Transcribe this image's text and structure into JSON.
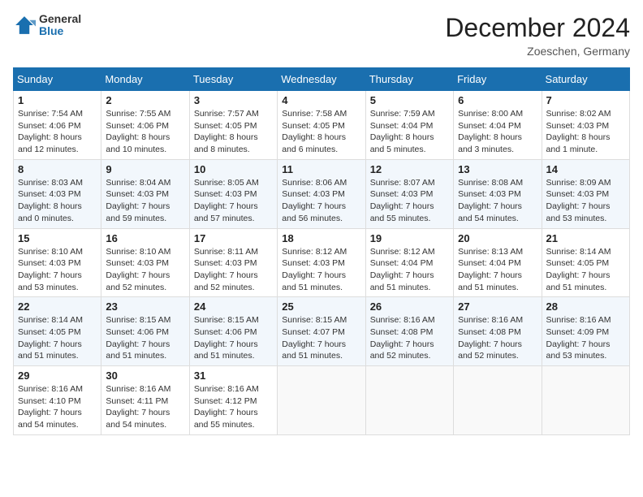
{
  "logo": {
    "general": "General",
    "blue": "Blue"
  },
  "title": "December 2024",
  "location": "Zoeschen, Germany",
  "days_of_week": [
    "Sunday",
    "Monday",
    "Tuesday",
    "Wednesday",
    "Thursday",
    "Friday",
    "Saturday"
  ],
  "weeks": [
    [
      {
        "day": "1",
        "sunrise": "7:54 AM",
        "sunset": "4:06 PM",
        "daylight": "8 hours and 12 minutes."
      },
      {
        "day": "2",
        "sunrise": "7:55 AM",
        "sunset": "4:06 PM",
        "daylight": "8 hours and 10 minutes."
      },
      {
        "day": "3",
        "sunrise": "7:57 AM",
        "sunset": "4:05 PM",
        "daylight": "8 hours and 8 minutes."
      },
      {
        "day": "4",
        "sunrise": "7:58 AM",
        "sunset": "4:05 PM",
        "daylight": "8 hours and 6 minutes."
      },
      {
        "day": "5",
        "sunrise": "7:59 AM",
        "sunset": "4:04 PM",
        "daylight": "8 hours and 5 minutes."
      },
      {
        "day": "6",
        "sunrise": "8:00 AM",
        "sunset": "4:04 PM",
        "daylight": "8 hours and 3 minutes."
      },
      {
        "day": "7",
        "sunrise": "8:02 AM",
        "sunset": "4:03 PM",
        "daylight": "8 hours and 1 minute."
      }
    ],
    [
      {
        "day": "8",
        "sunrise": "8:03 AM",
        "sunset": "4:03 PM",
        "daylight": "8 hours and 0 minutes."
      },
      {
        "day": "9",
        "sunrise": "8:04 AM",
        "sunset": "4:03 PM",
        "daylight": "7 hours and 59 minutes."
      },
      {
        "day": "10",
        "sunrise": "8:05 AM",
        "sunset": "4:03 PM",
        "daylight": "7 hours and 57 minutes."
      },
      {
        "day": "11",
        "sunrise": "8:06 AM",
        "sunset": "4:03 PM",
        "daylight": "7 hours and 56 minutes."
      },
      {
        "day": "12",
        "sunrise": "8:07 AM",
        "sunset": "4:03 PM",
        "daylight": "7 hours and 55 minutes."
      },
      {
        "day": "13",
        "sunrise": "8:08 AM",
        "sunset": "4:03 PM",
        "daylight": "7 hours and 54 minutes."
      },
      {
        "day": "14",
        "sunrise": "8:09 AM",
        "sunset": "4:03 PM",
        "daylight": "7 hours and 53 minutes."
      }
    ],
    [
      {
        "day": "15",
        "sunrise": "8:10 AM",
        "sunset": "4:03 PM",
        "daylight": "7 hours and 53 minutes."
      },
      {
        "day": "16",
        "sunrise": "8:10 AM",
        "sunset": "4:03 PM",
        "daylight": "7 hours and 52 minutes."
      },
      {
        "day": "17",
        "sunrise": "8:11 AM",
        "sunset": "4:03 PM",
        "daylight": "7 hours and 52 minutes."
      },
      {
        "day": "18",
        "sunrise": "8:12 AM",
        "sunset": "4:03 PM",
        "daylight": "7 hours and 51 minutes."
      },
      {
        "day": "19",
        "sunrise": "8:12 AM",
        "sunset": "4:04 PM",
        "daylight": "7 hours and 51 minutes."
      },
      {
        "day": "20",
        "sunrise": "8:13 AM",
        "sunset": "4:04 PM",
        "daylight": "7 hours and 51 minutes."
      },
      {
        "day": "21",
        "sunrise": "8:14 AM",
        "sunset": "4:05 PM",
        "daylight": "7 hours and 51 minutes."
      }
    ],
    [
      {
        "day": "22",
        "sunrise": "8:14 AM",
        "sunset": "4:05 PM",
        "daylight": "7 hours and 51 minutes."
      },
      {
        "day": "23",
        "sunrise": "8:15 AM",
        "sunset": "4:06 PM",
        "daylight": "7 hours and 51 minutes."
      },
      {
        "day": "24",
        "sunrise": "8:15 AM",
        "sunset": "4:06 PM",
        "daylight": "7 hours and 51 minutes."
      },
      {
        "day": "25",
        "sunrise": "8:15 AM",
        "sunset": "4:07 PM",
        "daylight": "7 hours and 51 minutes."
      },
      {
        "day": "26",
        "sunrise": "8:16 AM",
        "sunset": "4:08 PM",
        "daylight": "7 hours and 52 minutes."
      },
      {
        "day": "27",
        "sunrise": "8:16 AM",
        "sunset": "4:08 PM",
        "daylight": "7 hours and 52 minutes."
      },
      {
        "day": "28",
        "sunrise": "8:16 AM",
        "sunset": "4:09 PM",
        "daylight": "7 hours and 53 minutes."
      }
    ],
    [
      {
        "day": "29",
        "sunrise": "8:16 AM",
        "sunset": "4:10 PM",
        "daylight": "7 hours and 54 minutes."
      },
      {
        "day": "30",
        "sunrise": "8:16 AM",
        "sunset": "4:11 PM",
        "daylight": "7 hours and 54 minutes."
      },
      {
        "day": "31",
        "sunrise": "8:16 AM",
        "sunset": "4:12 PM",
        "daylight": "7 hours and 55 minutes."
      },
      null,
      null,
      null,
      null
    ]
  ],
  "labels": {
    "sunrise": "Sunrise:",
    "sunset": "Sunset:",
    "daylight": "Daylight:"
  }
}
